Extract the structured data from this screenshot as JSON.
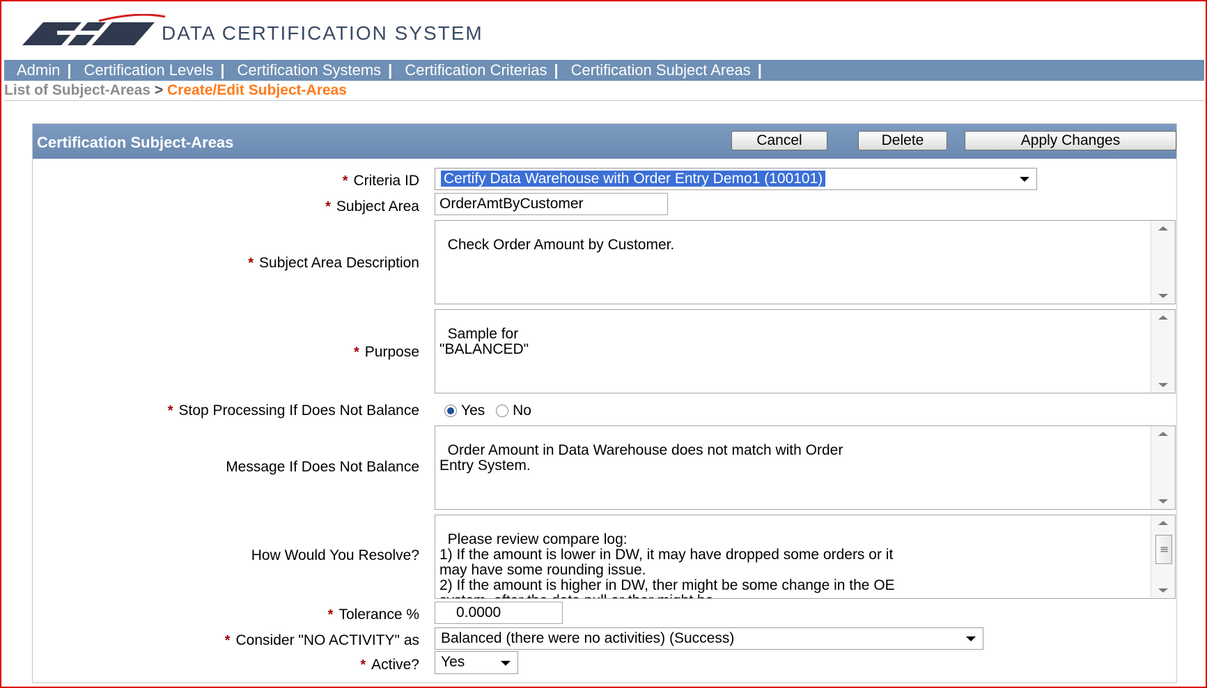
{
  "app": {
    "title": "DATA CERTIFICATION SYSTEM"
  },
  "nav": {
    "items": [
      {
        "label": "Admin"
      },
      {
        "label": "Certification Levels"
      },
      {
        "label": "Certification Systems"
      },
      {
        "label": "Certification Criterias"
      },
      {
        "label": "Certification Subject Areas"
      }
    ],
    "separator": "|"
  },
  "breadcrumb": {
    "parent": "List of Subject-Areas",
    "arrow": ">",
    "current": "Create/Edit Subject-Areas"
  },
  "region": {
    "title": "Certification Subject-Areas",
    "buttons": {
      "cancel": "Cancel",
      "delete": "Delete",
      "apply": "Apply Changes"
    }
  },
  "form": {
    "required_mark": "*",
    "criteria_id": {
      "label": "Criteria ID",
      "value": "Certify Data Warehouse with Order Entry Demo1 (100101)"
    },
    "subject_area": {
      "label": "Subject Area",
      "value": "OrderAmtByCustomer"
    },
    "description": {
      "label": "Subject Area Description",
      "value": "Check Order Amount by Customer."
    },
    "purpose": {
      "label": "Purpose",
      "value": "Sample for\n\"BALANCED\""
    },
    "stop_processing": {
      "label": "Stop Processing If Does Not Balance",
      "options": [
        "Yes",
        "No"
      ],
      "selected": "Yes"
    },
    "message": {
      "label": "Message If Does Not Balance",
      "value": "Order Amount in Data Warehouse does not match with Order\nEntry System."
    },
    "resolve": {
      "label": "How Would You Resolve?",
      "value": "Please review compare log:\n1) If the amount is lower in DW, it may have dropped some orders or it\nmay have some rounding issue.\n2) If the amount is higher in DW, ther might be some change in the OE\nsystem, after the data pull or ther might be"
    },
    "tolerance": {
      "label": "Tolerance %",
      "value": "0.0000"
    },
    "no_activity": {
      "label": "Consider \"NO ACTIVITY\" as",
      "value": "Balanced (there were no activities) (Success)"
    },
    "active": {
      "label": "Active?",
      "value": "Yes"
    }
  },
  "colors": {
    "nav_bg": "#6f8fb4",
    "breadcrumb_current": "#ff7a1a",
    "required": "#a40000",
    "frame": "#e00000"
  }
}
